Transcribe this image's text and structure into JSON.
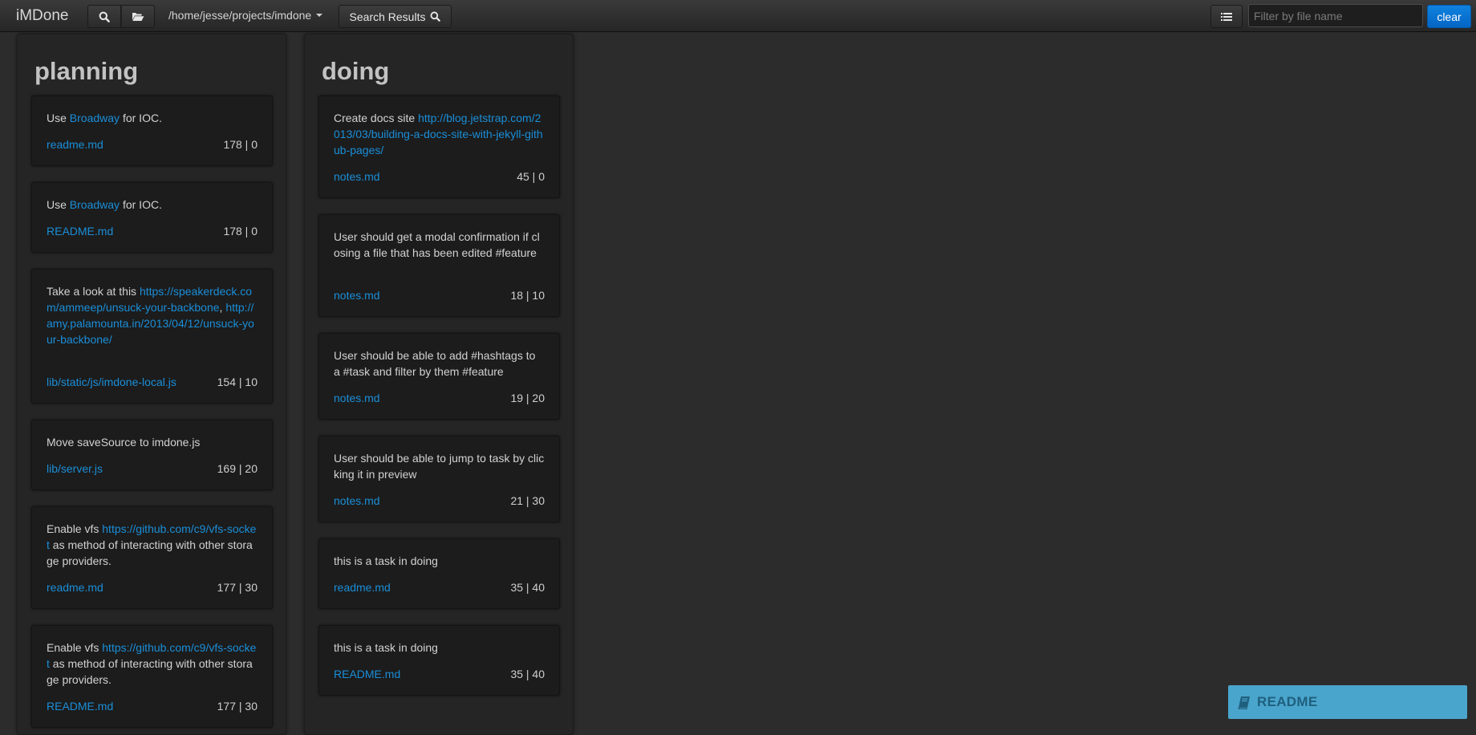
{
  "app": {
    "brand": "iMDone",
    "path": "/home/jesse/projects/imdone",
    "search_results_label": "Search Results",
    "filter_placeholder": "Filter by file name",
    "clear_label": "clear",
    "readme_label": "README"
  },
  "icons": {
    "search": "search-icon",
    "folder": "folder-open-icon",
    "list": "list-icon",
    "book": "book-icon"
  },
  "colors": {
    "link": "#1a8ed8",
    "clear_button": "#0a74d6",
    "readme_bar": "#4aa5cc"
  },
  "lists": [
    {
      "title": "planning",
      "tasks": [
        {
          "parts": [
            {
              "t": "Use "
            },
            {
              "t": "Broadway",
              "link": true
            },
            {
              "t": " for IOC."
            }
          ],
          "file": "readme.md",
          "lines": "178 | 0"
        },
        {
          "parts": [
            {
              "t": "Use "
            },
            {
              "t": "Broadway",
              "link": true
            },
            {
              "t": " for IOC."
            }
          ],
          "file": "README.md",
          "lines": "178 | 0"
        },
        {
          "parts": [
            {
              "t": "Take a look at this "
            },
            {
              "t": "https://speakerdeck.com/ammeep/unsuck-your-backbone",
              "link": true
            },
            {
              "t": ", "
            },
            {
              "t": "http://amy.palamounta.in/2013/04/12/unsuck-your-backbone/",
              "link": true
            }
          ],
          "file": "lib/static/js/imdone-local.js",
          "lines": "154 | 10"
        },
        {
          "parts": [
            {
              "t": "Move saveSource to imdone.js"
            }
          ],
          "file": "lib/server.js",
          "lines": "169 | 20"
        },
        {
          "parts": [
            {
              "t": "Enable vfs "
            },
            {
              "t": "https://github.com/c9/vfs-socket",
              "link": true
            },
            {
              "t": " as method of interacting with other storage providers."
            }
          ],
          "file": "readme.md",
          "lines": "177 | 30"
        },
        {
          "parts": [
            {
              "t": "Enable vfs "
            },
            {
              "t": "https://github.com/c9/vfs-socket",
              "link": true
            },
            {
              "t": " as method of interacting with other storage providers."
            }
          ],
          "file": "README.md",
          "lines": "177 | 30"
        }
      ]
    },
    {
      "title": "doing",
      "tasks": [
        {
          "parts": [
            {
              "t": "Create docs site "
            },
            {
              "t": "http://blog.jetstrap.com/2013/03/building-a-docs-site-with-jekyll-github-pages/",
              "link": true
            }
          ],
          "file": "notes.md",
          "lines": "45 | 0"
        },
        {
          "parts": [
            {
              "t": "User should get a modal confirmation if closing a file that has been edited #feature"
            }
          ],
          "file": "notes.md",
          "lines": "18 | 10"
        },
        {
          "parts": [
            {
              "t": "User should be able to add #hashtags to a #task and filter by them #feature"
            }
          ],
          "file": "notes.md",
          "lines": "19 | 20"
        },
        {
          "parts": [
            {
              "t": "User should be able to jump to task by clicking it in preview"
            }
          ],
          "file": "notes.md",
          "lines": "21 | 30"
        },
        {
          "parts": [
            {
              "t": "this is a task in doing"
            }
          ],
          "file": "readme.md",
          "lines": "35 | 40"
        },
        {
          "parts": [
            {
              "t": "this is a task in doing"
            }
          ],
          "file": "README.md",
          "lines": "35 | 40"
        }
      ]
    }
  ]
}
